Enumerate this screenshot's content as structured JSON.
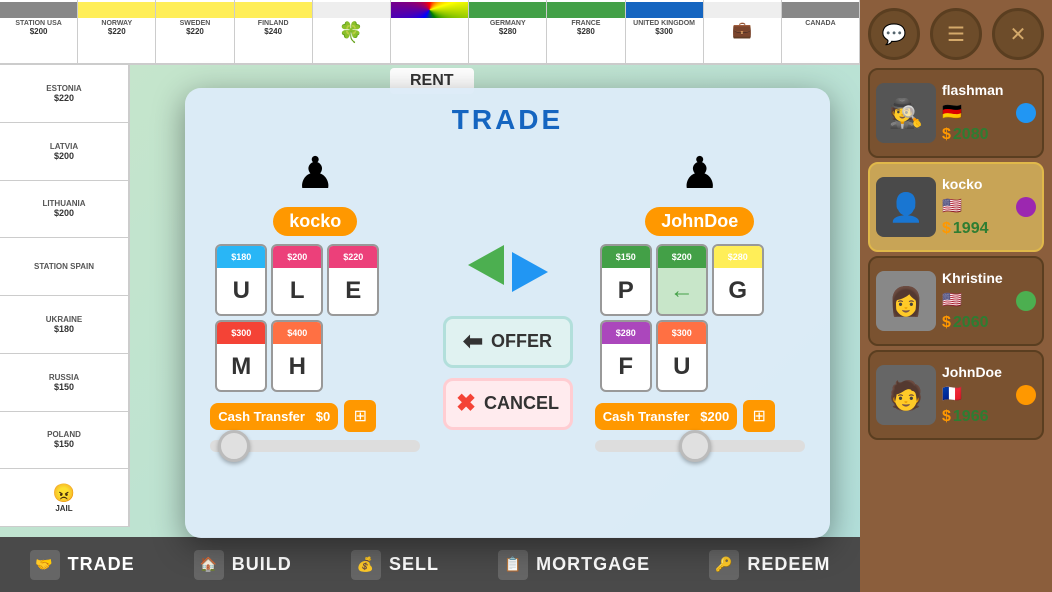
{
  "header": {
    "title": "TRADE",
    "rent": "RENT"
  },
  "dialog": {
    "title": "TRADE",
    "offer_btn": "OFFER",
    "cancel_btn": "CANCEL"
  },
  "players": {
    "left": {
      "name": "kocko",
      "pawn": "🟣",
      "pawn_color": "purple",
      "properties": [
        {
          "price": "$180",
          "letter": "U",
          "color": "c-lblue"
        },
        {
          "price": "$200",
          "letter": "L",
          "color": "c-pink"
        },
        {
          "price": "$220",
          "letter": "E",
          "color": "c-pink"
        },
        {
          "price": "$300",
          "letter": "M",
          "color": "c-red"
        },
        {
          "price": "$400",
          "letter": "H",
          "color": "c-orange"
        }
      ],
      "cash_label": "Cash Transfer",
      "cash_value": "$0",
      "slider_pos": "left"
    },
    "right": {
      "name": "JohnDoe",
      "pawn": "🟡",
      "pawn_color": "yellow",
      "properties": [
        {
          "price": "$150",
          "letter": "P",
          "color": "c-green"
        },
        {
          "price": "$200",
          "letter": "←",
          "color": "c-green"
        },
        {
          "price": "$280",
          "letter": "G",
          "color": "c-yellow"
        },
        {
          "price": "$280",
          "letter": "F",
          "color": "c-yellow"
        },
        {
          "price": "$300",
          "letter": "U",
          "color": "c-orange"
        }
      ],
      "cash_label": "Cash Transfer",
      "cash_value": "$200",
      "slider_pos": "mid"
    }
  },
  "sidebar": {
    "players": [
      {
        "name": "flashman",
        "flag": "🇩🇪",
        "money": "2080",
        "avatar_char": "👤",
        "token_color": "#2196f3",
        "active": false
      },
      {
        "name": "kocko",
        "flag": "🇺🇸",
        "money": "1994",
        "avatar_char": "👤",
        "token_color": "#9c27b0",
        "active": true
      },
      {
        "name": "Khristine",
        "flag": "🇺🇸",
        "money": "2060",
        "avatar_char": "👤",
        "token_color": "#4caf50",
        "active": false
      },
      {
        "name": "JohnDoe",
        "flag": "🇫🇷",
        "money": "1966",
        "avatar_char": "👤",
        "token_color": "#ff9800",
        "active": false
      }
    ],
    "chat_icon": "💬",
    "menu_icon": "☰",
    "close_icon": "✕"
  },
  "bottom_nav": {
    "items": [
      {
        "label": "TRADE",
        "icon": "🤝"
      },
      {
        "label": "BUILD",
        "icon": "🏠"
      },
      {
        "label": "SELL",
        "icon": "💰"
      },
      {
        "label": "MORTGAGE",
        "icon": "📋"
      },
      {
        "label": "REDEEM",
        "icon": "🔑"
      }
    ]
  },
  "board": {
    "top_tiles": [
      {
        "name": "STATION USA",
        "price": "$200",
        "color": ""
      },
      {
        "name": "NORWAY",
        "price": "$220",
        "color": "c-yellow"
      },
      {
        "name": "SWEDEN",
        "price": "$220",
        "color": "c-yellow"
      },
      {
        "name": "FINLAND",
        "price": "$240",
        "color": "c-yellow"
      },
      {
        "name": "🍀",
        "price": "",
        "color": ""
      },
      {
        "name": "",
        "price": "",
        "color": ""
      },
      {
        "name": "GERMANY",
        "price": "$280",
        "color": "c-green"
      },
      {
        "name": "FRANCE",
        "price": "$280",
        "color": "c-green"
      },
      {
        "name": "UNITED KINGDOM",
        "price": "$300",
        "color": "c-dblue"
      },
      {
        "name": "",
        "price": "",
        "color": ""
      },
      {
        "name": "CANADA",
        "price": "",
        "color": ""
      }
    ],
    "left_tiles": [
      {
        "name": "ESTONIA",
        "price": "$220"
      },
      {
        "name": "LATVIA",
        "price": "$200"
      },
      {
        "name": "LITHUANIA",
        "price": "$200"
      },
      {
        "name": "STATION SPAIN",
        "price": ""
      },
      {
        "name": "UKRAINE",
        "price": "$180"
      },
      {
        "name": "RUSSIA",
        "price": "$150"
      },
      {
        "name": "POLAND",
        "price": "$150"
      },
      {
        "name": "",
        "price": ""
      }
    ]
  }
}
